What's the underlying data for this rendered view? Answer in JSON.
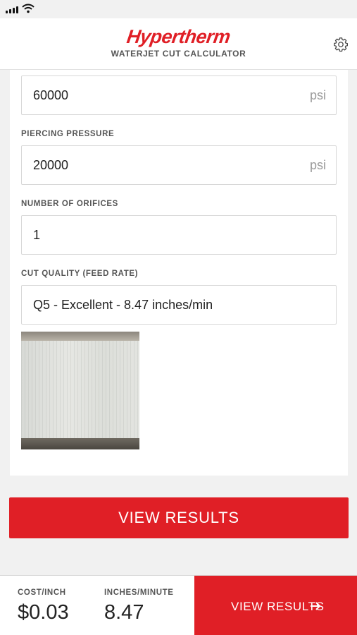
{
  "header": {
    "logo_text": "Hypertherm",
    "subtitle": "WATERJET CUT CALCULATOR",
    "settings_icon": "gear-icon"
  },
  "form": {
    "cutting_pressure": {
      "value": "60000",
      "unit": "psi"
    },
    "piercing_pressure": {
      "label": "PIERCING PRESSURE",
      "value": "20000",
      "unit": "psi"
    },
    "orifices": {
      "label": "NUMBER OF ORIFICES",
      "value": "1"
    },
    "cut_quality": {
      "label": "CUT QUALITY (FEED RATE)",
      "value": "Q5 - Excellent - 8.47 inches/min"
    }
  },
  "view_results_label": "VIEW RESULTS",
  "footer": {
    "cost_label": "COST/INCH",
    "cost_value": "$0.03",
    "ipm_label": "INCHES/MINUTE",
    "ipm_value": "8.47",
    "button_label": "VIEW RESULTS"
  },
  "colors": {
    "accent": "#e01f26"
  }
}
